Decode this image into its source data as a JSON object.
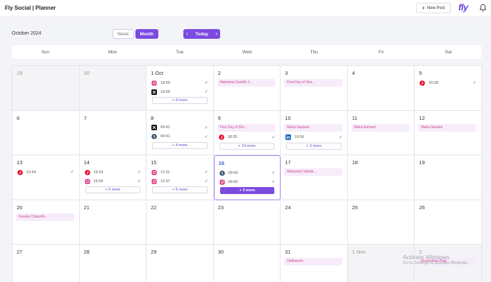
{
  "header": {
    "title": "Fly Social | Planner",
    "new_post_label": "New Post",
    "logo_text": "fly"
  },
  "toolbar": {
    "month_label": "October 2024",
    "view_week": "Week",
    "view_month": "Month",
    "today_label": "Today"
  },
  "weekdays": [
    "Sun",
    "Mon",
    "Tue",
    "Wed",
    "Thu",
    "Fri",
    "Sat"
  ],
  "days": [
    {
      "label": "29",
      "outside": true
    },
    {
      "label": "30",
      "outside": true
    },
    {
      "label": "1 Oct",
      "posts": [
        {
          "platform": "instagram",
          "time": "18:00"
        },
        {
          "platform": "x",
          "time": "18:00"
        }
      ],
      "more": "+ 9 more"
    },
    {
      "label": "2",
      "event": "Mahatma Gandhi J..."
    },
    {
      "label": "3",
      "event": "First Day of Sha..."
    },
    {
      "label": "4"
    },
    {
      "label": "5",
      "posts": [
        {
          "platform": "pinterest",
          "time": "20:28"
        }
      ]
    },
    {
      "label": "6"
    },
    {
      "label": "7"
    },
    {
      "label": "8",
      "posts": [
        {
          "platform": "x",
          "time": "09:41"
        },
        {
          "platform": "tumblr",
          "time": "09:41"
        }
      ],
      "more": "+ 4 more"
    },
    {
      "label": "9",
      "event": "First Day of Dur...",
      "posts": [
        {
          "platform": "pinterest",
          "time": "18:25"
        }
      ],
      "more": "+ 13 more"
    },
    {
      "label": "10",
      "event": "Maha Saptami",
      "posts": [
        {
          "platform": "linkedin",
          "time": "16:56"
        }
      ],
      "more": "+ 3 more"
    },
    {
      "label": "11",
      "event": "Maha Ashtami"
    },
    {
      "label": "12",
      "event": "Maha Navami"
    },
    {
      "label": "13",
      "posts": [
        {
          "platform": "pinterest",
          "time": "10:54"
        }
      ]
    },
    {
      "label": "14",
      "posts": [
        {
          "platform": "pinterest",
          "time": "19:24"
        },
        {
          "platform": "instagram",
          "time": "16:54"
        }
      ],
      "more": "+ 6 more"
    },
    {
      "label": "15",
      "posts": [
        {
          "platform": "instagram",
          "time": "12:11"
        },
        {
          "platform": "instagram",
          "time": "12:07"
        }
      ],
      "more": "+ 5 more"
    },
    {
      "label": "16",
      "today": true,
      "posts": [
        {
          "platform": "tumblr",
          "time": "09:00"
        },
        {
          "platform": "instagram",
          "time": "09:00"
        }
      ],
      "more": "+ 3 more"
    },
    {
      "label": "17",
      "event": "Maharishi Valmik..."
    },
    {
      "label": "18"
    },
    {
      "label": "19"
    },
    {
      "label": "20",
      "event": "Karaka Chaturthi..."
    },
    {
      "label": "21"
    },
    {
      "label": "22"
    },
    {
      "label": "23"
    },
    {
      "label": "24"
    },
    {
      "label": "25"
    },
    {
      "label": "26"
    },
    {
      "label": "27"
    },
    {
      "label": "28"
    },
    {
      "label": "29"
    },
    {
      "label": "30"
    },
    {
      "label": "31",
      "event": "Halloween"
    },
    {
      "label": "1 Nov",
      "outside": true
    },
    {
      "label": "2",
      "outside": true,
      "event": "Govardhan Puja"
    }
  ],
  "watermark": {
    "title": "Activate Windows",
    "subtitle": "Go to Settings to activate Windows."
  },
  "colors": {
    "accent": "#7c4be0",
    "event_text": "#d0458f",
    "event_bg": "#f6ecfa"
  }
}
